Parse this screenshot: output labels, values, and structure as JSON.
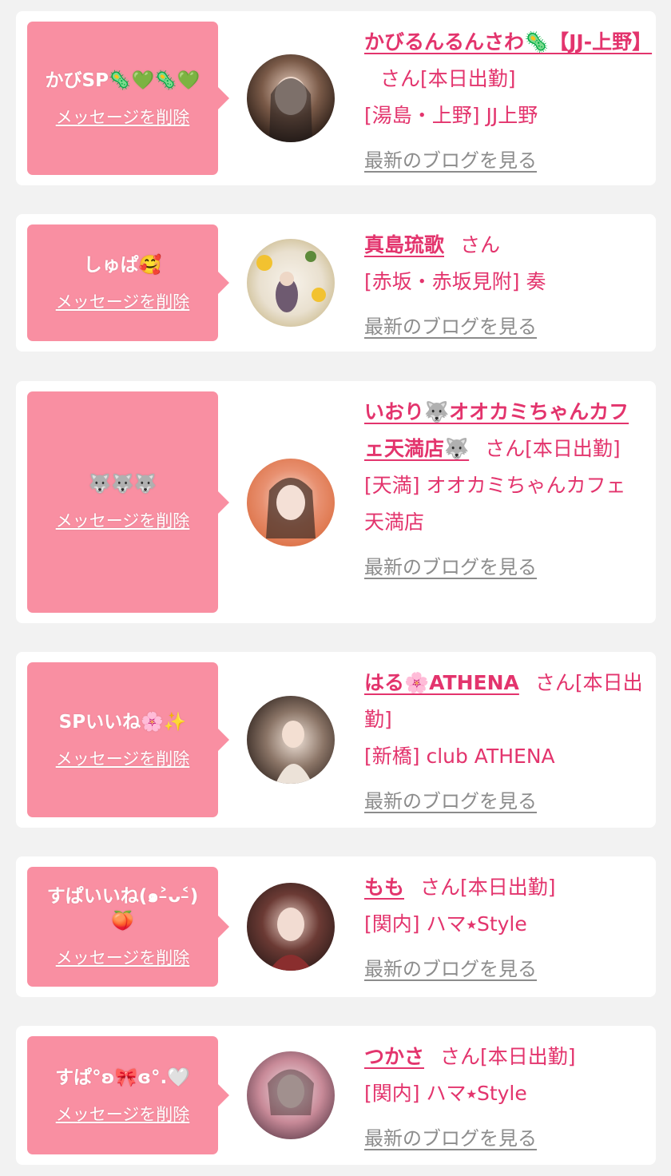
{
  "delete_label": "メッセージを削除",
  "blog_label": "最新のブログを見る",
  "colors": {
    "page_bg": "#f2f2f2",
    "bubble": "#f98fa2",
    "name": "#e3346d",
    "link_gray": "#8c8c8c"
  },
  "items": [
    {
      "message": "かびSP🦠💚🦠💚",
      "name": "かびるんるんさわ🦠【JJ-上野】",
      "suffix": "さん[本日出勤]",
      "shop": "[湯島・上野] JJ上野",
      "avatar_icon": "avatar-photo"
    },
    {
      "message": "しゅぱ🥰",
      "name": "真島琉歌",
      "suffix": "さん",
      "shop": "[赤坂・赤坂見附] 奏",
      "avatar_icon": "avatar-photo"
    },
    {
      "message": "🐺🐺🐺",
      "name": "いおり🐺オオカミちゃんカフェ天満店🐺",
      "suffix": "さん[本日出勤]",
      "shop": "[天満] オオカミちゃんカフェ天満店",
      "avatar_icon": "avatar-photo"
    },
    {
      "message": "SPいいね🌸✨",
      "name": "はる🌸ATHENA",
      "suffix": "さん[本日出勤]",
      "shop": "[新橋] club ATHENA",
      "avatar_icon": "avatar-photo"
    },
    {
      "message": "すぱいいね(๑˃̵ᴗ˂̵)🍑",
      "name": "もも",
      "suffix": "さん[本日出勤]",
      "shop": "[関内] ハマ⭑Style",
      "avatar_icon": "avatar-photo"
    },
    {
      "message": "すぱ°ʚ🎀ɞ°.🤍",
      "name": "つかさ",
      "suffix": "さん[本日出勤]",
      "shop": "[関内] ハマ⭑Style",
      "avatar_icon": "avatar-photo"
    }
  ]
}
